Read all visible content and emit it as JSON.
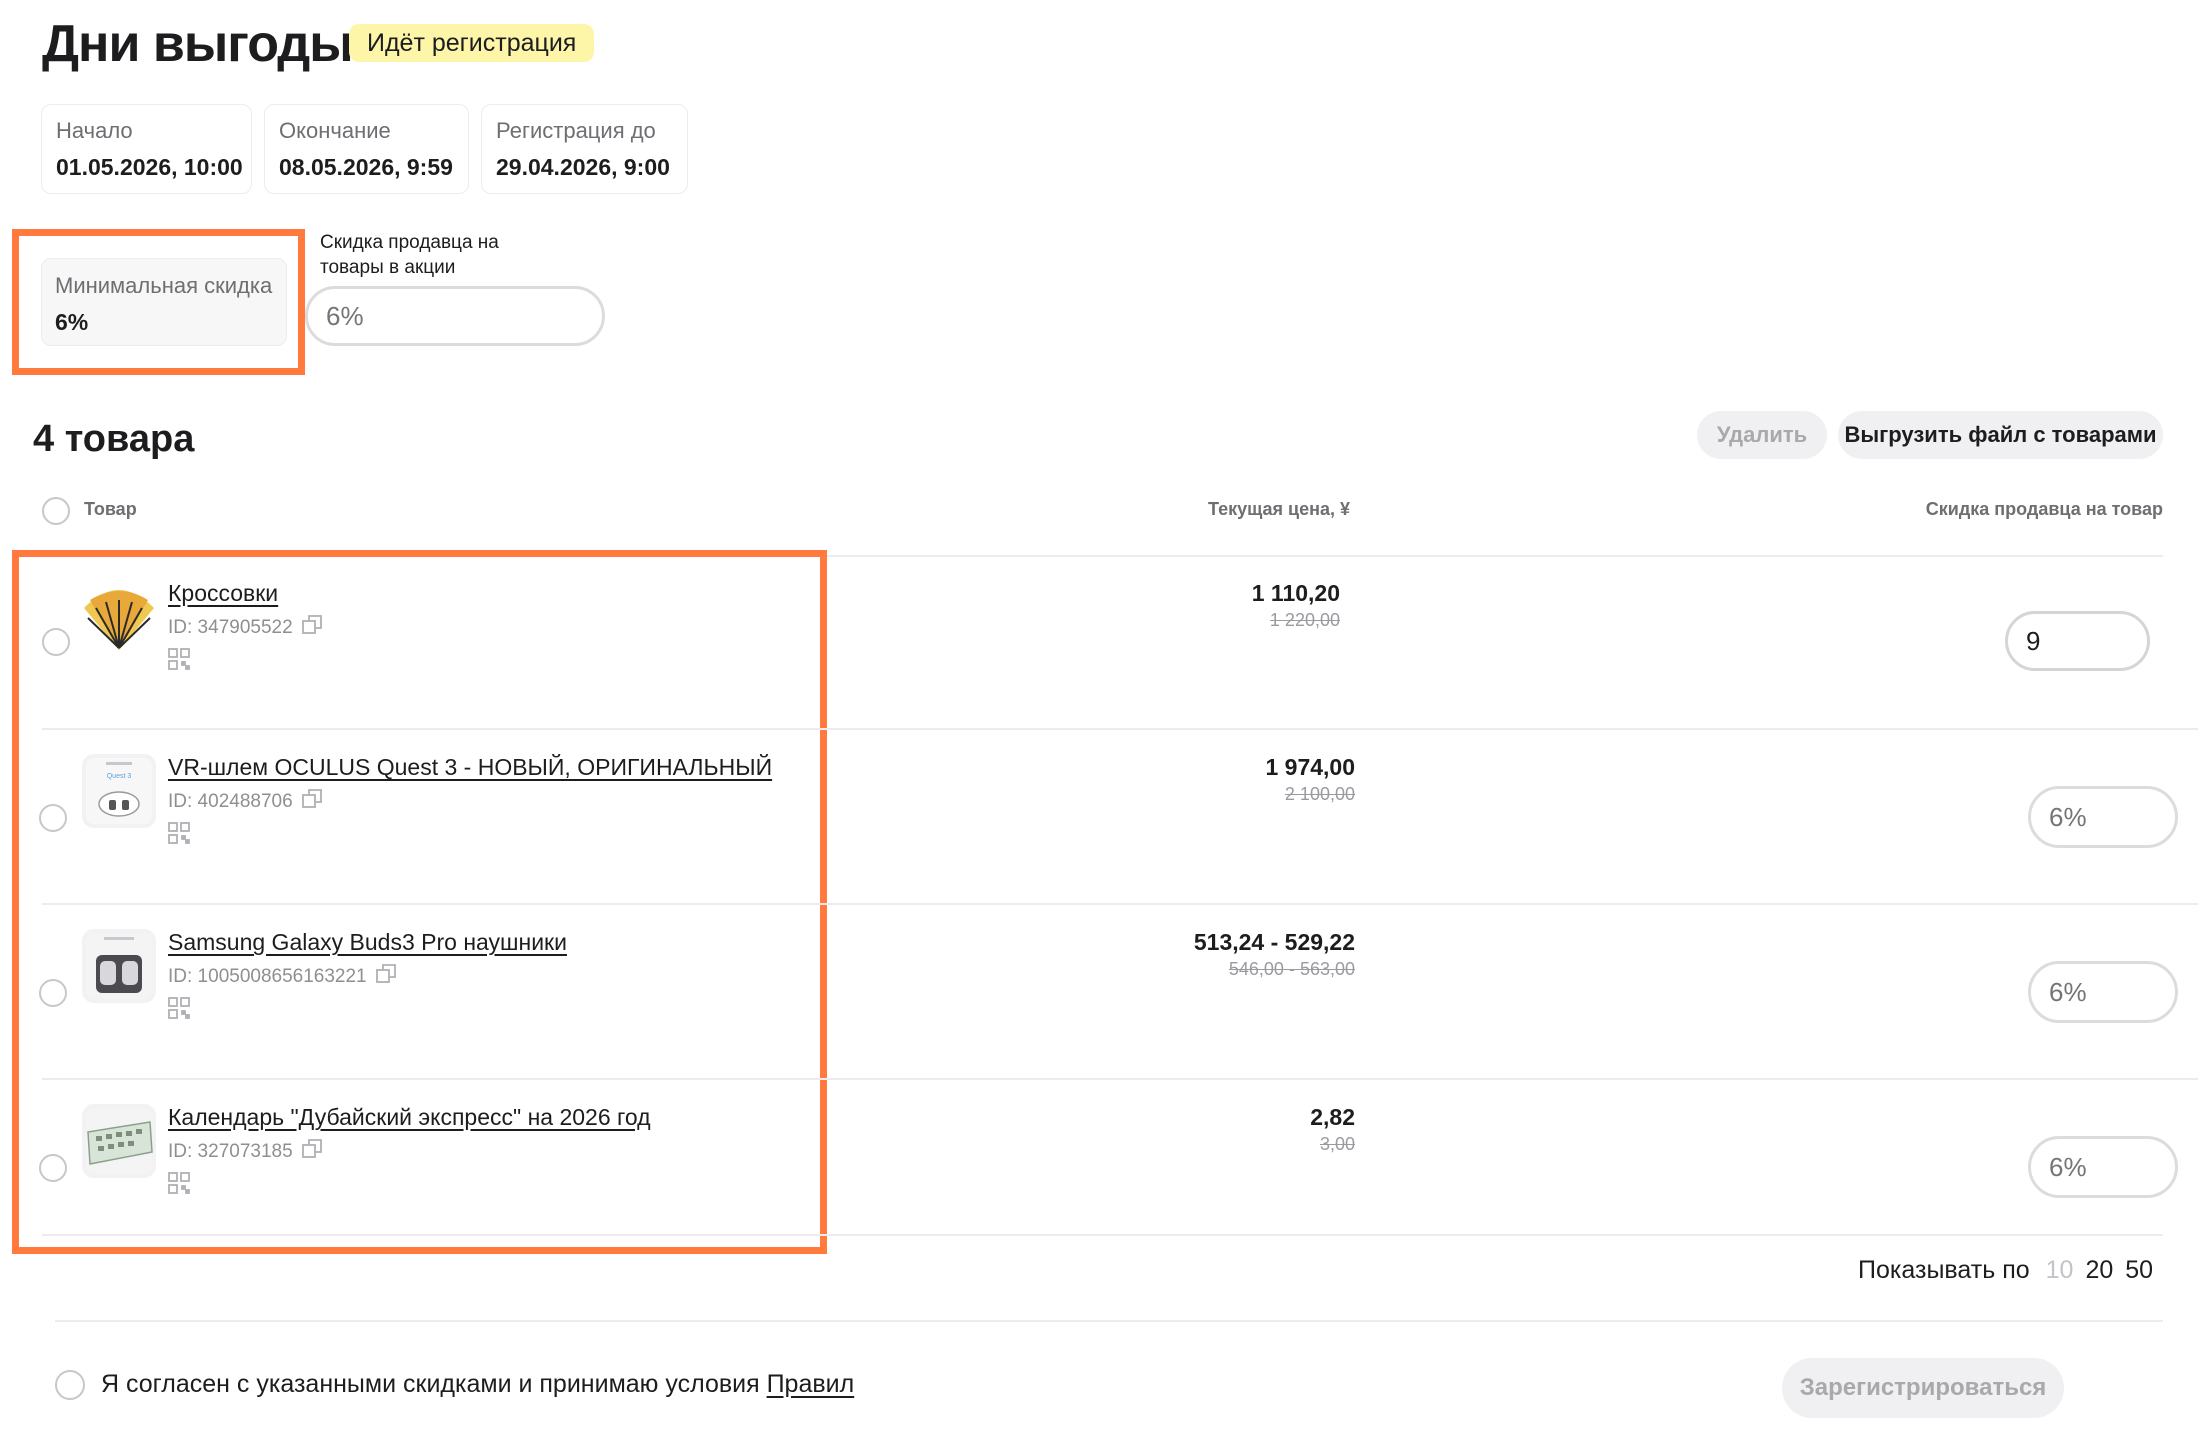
{
  "header": {
    "title": "Дни выгоды",
    "status_badge": "Идёт регистрация"
  },
  "dates": [
    {
      "label": "Начало",
      "value": "01.05.2026, 10:00"
    },
    {
      "label": "Окончание",
      "value": "08.05.2026, 9:59"
    },
    {
      "label": "Регистрация до",
      "value": "29.04.2026, 9:00"
    }
  ],
  "min_discount": {
    "label": "Минимальная скидка",
    "value": "6%"
  },
  "seller_discount": {
    "label": "Скидка продавца на товары в акции",
    "placeholder": "6%"
  },
  "products_section": {
    "count_title": "4 товара",
    "delete_label": "Удалить",
    "export_label": "Выгрузить файл с товарами"
  },
  "table": {
    "col_product": "Товар",
    "col_price": "Текущая цена, ¥",
    "col_discount": "Скидка продавца на товар"
  },
  "products": [
    {
      "name": "Кроссовки",
      "id": "ID: 347905522",
      "price": "1 110,20",
      "old_price": "1 220,00",
      "discount_value": "9",
      "discount_placeholder": ""
    },
    {
      "name": "VR-шлем OCULUS Quest 3 - НОВЫЙ, ОРИГИНАЛЬНЫЙ",
      "id": "ID: 402488706",
      "price": "1 974,00",
      "old_price": "2 100,00",
      "discount_value": "",
      "discount_placeholder": "6%"
    },
    {
      "name": "Samsung Galaxy Buds3 Pro наушники",
      "id": "ID: 1005008656163221",
      "price": "513,24 - 529,22",
      "old_price": "546,00 - 563,00",
      "discount_value": "",
      "discount_placeholder": "6%"
    },
    {
      "name": "Календарь \"Дубайский экспресс\" на 2026 год",
      "id": "ID: 327073185",
      "price": "2,82",
      "old_price": "3,00",
      "discount_value": "",
      "discount_placeholder": "6%"
    }
  ],
  "pagination": {
    "label": "Показывать по",
    "options": [
      "10",
      "20",
      "50"
    ],
    "selected": "10"
  },
  "footer": {
    "agree_text": "Я согласен с указанными скидками и принимаю условия ",
    "rules_link": "Правил",
    "register_label": "Зарегистрироваться"
  },
  "colors": {
    "highlight": "#ff7a3c",
    "badge_bg": "#fdf6a8"
  }
}
